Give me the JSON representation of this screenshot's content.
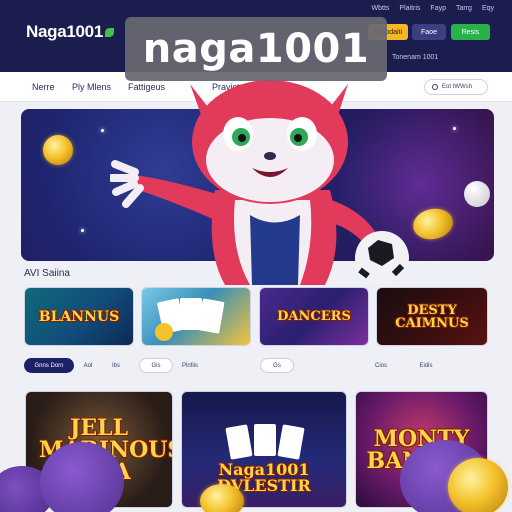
{
  "header": {
    "logo": "Naga1001",
    "top_links": [
      "Wbtts",
      "Plaitris",
      "Fayp",
      "Tarrg",
      "Eqy"
    ],
    "buttons": [
      "Tusodaiti",
      "Faoe",
      "Resis"
    ],
    "promo_text": "Tonenam 1001"
  },
  "overlay_title": "naga1001",
  "nav": {
    "items": [
      "Nerre",
      "Ply Mlens",
      "Fattigeus",
      "Pravicts"
    ],
    "search_label": "Eot tWWsh"
  },
  "section": {
    "title": "AVI Saiina"
  },
  "games_row1": [
    "BLANNUS",
    "",
    "DANCERS",
    "DESTY CAIMNUS"
  ],
  "filters": [
    "Gnns Dorn",
    "Aol",
    "Ibs",
    "Gis",
    "Plnfiis",
    "Gs",
    "Cios",
    "Eidis"
  ],
  "games_row2": [
    "JELL MARINOUS IDEA",
    "Naga1001 DVLESTIR",
    "MONTY BANNOS"
  ],
  "colors": {
    "header_bg": "#1a1d4d",
    "accent_green": "#27b24a",
    "accent_gold": "#f5b820",
    "overlay_bg": "#68686f"
  }
}
